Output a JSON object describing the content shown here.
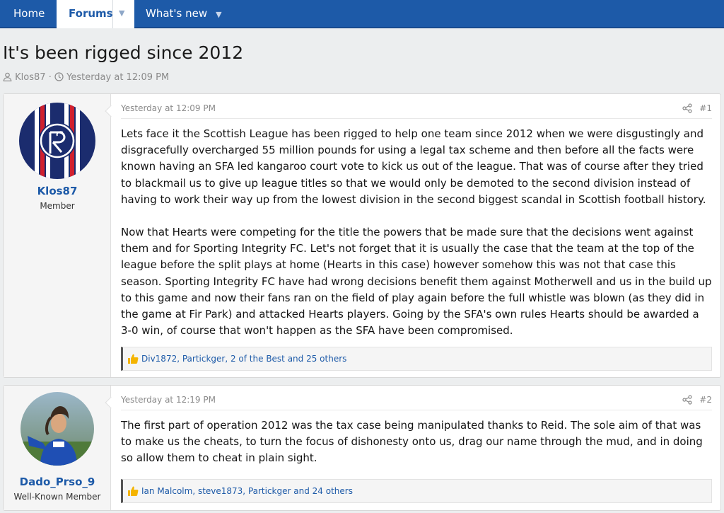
{
  "nav": {
    "home": "Home",
    "forums": "Forums",
    "whats_new": "What's new"
  },
  "thread": {
    "title": "It's been rigged since 2012",
    "author": "Klos87",
    "separator": "·",
    "time": "Yesterday at 12:09 PM"
  },
  "posts": [
    {
      "username": "Klos87",
      "user_title": "Member",
      "date": "Yesterday at 12:09 PM",
      "number": "#1",
      "paragraphs": [
        "Lets face it the Scottish League has been rigged to help one team since 2012 when we were disgustingly and disgracefully overcharged 55 million pounds for using a legal tax scheme and then before all the facts were known having an SFA led kangaroo court vote to kick us out of the league. That was of course after they tried to blackmail us to give up league titles so that we would only be demoted to the second division instead of having to work their way up from the lowest division in the second biggest scandal in Scottish football history.",
        "Now that Hearts were competing for the title the powers that be made sure that the decisions went against them and for Sporting Integrity FC. Let's not forget that it is usually the case that the team at the top of the league before the split plays at home (Hearts in this case) however somehow this was not that case this season. Sporting Integrity FC have had wrong decisions benefit them against Motherwell and us in the build up to this game and now their fans ran on the field of play again before the full whistle was blown (as they did in the game at Fir Park) and attacked Hearts players. Going by the SFA's own rules Hearts should be awarded a 3-0 win, of course that won't happen as the SFA have been compromised."
      ],
      "reactions": "Div1872, Partickger, 2 of the Best and 25 others"
    },
    {
      "username": "Dado_Prso_9",
      "user_title": "Well-Known Member",
      "date": "Yesterday at 12:19 PM",
      "number": "#2",
      "paragraphs": [
        "The first part of operation 2012 was the tax case being manipulated thanks to Reid. The sole aim of that was to make us the cheats, to turn the focus of dishonesty onto us, drag our name through the mud, and in doing so allow them to cheat in plain sight."
      ],
      "reactions": "Ian Malcolm, steve1873, Partickger and 24 others"
    }
  ],
  "colors": {
    "nav_bg": "#1d5aa8",
    "link": "#1d5aa8",
    "page_bg": "#eceeef"
  }
}
